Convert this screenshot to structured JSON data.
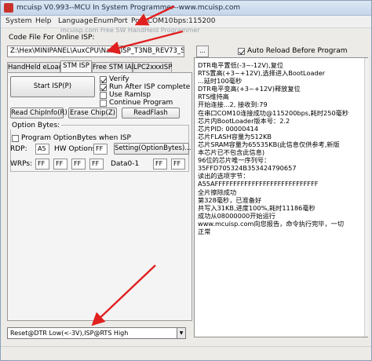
{
  "window": {
    "title": "mcuisp V0.993--MCU In System Programmer--www.mcuisp.com"
  },
  "menu": {
    "items": [
      "System",
      "Help",
      "Language",
      "EnumPort",
      "Port:COM10",
      "bps:115200"
    ]
  },
  "watermark": "mcuisp.com Free SW HandHeld Programmer",
  "codefile": {
    "label": "Code File For Online ISP:",
    "path": "Z:\\Hex\\MINIPANEL\\AuxCPU\\Nano\\ISP_T3NB_REV73_ST.hex",
    "browse_label": "...",
    "auto_reload_label": "Auto Reload Before Program",
    "auto_reload_checked": true
  },
  "tabs": [
    "HandHeld eLoader",
    "STM ISP",
    "Free STM IAP",
    "LPC2xxxISP"
  ],
  "active_tab": "STM ISP",
  "isp": {
    "start_label": "Start ISP(P)",
    "options": [
      {
        "label": "Verify",
        "checked": true
      },
      {
        "label": "Run After ISP complete",
        "checked": true
      },
      {
        "label": "Use RamIsp",
        "checked": false
      },
      {
        "label": "Continue Program",
        "checked": false
      }
    ],
    "buttons": [
      "Read ChipInfo(R)",
      "Erase Chip(Z)",
      "ReadFlash"
    ]
  },
  "option_bytes": {
    "group_title": "Option Bytes:",
    "program_label": "Program OptionBytes when ISP",
    "program_checked": false,
    "rdp_label": "RDP:",
    "rdp_value": "A5",
    "hw_label": "HW Options:",
    "hw_value": "FF",
    "setting_label": "Setting(OptionBytes)...",
    "wrps_label": "WRPs:",
    "wrps_values": [
      "FF",
      "FF",
      "FF",
      "FF"
    ],
    "data0_label": "Data0-1",
    "data_values": [
      "FF",
      "FF"
    ]
  },
  "dtr_combo": {
    "selected": "Reset@DTR Low(<-3V),ISP@RTS High"
  },
  "log_lines": [
    "DTR电平置低(-3~-12V),复位",
    "RTS置高(+3~+12V),选择进入BootLoader",
    "...延时100毫秒",
    "DTR电平变高(+3~+12V)释放复位",
    "RTS维持高",
    "开始连接...2, 接收到:79",
    "在串口COM10连接成功@115200bps,耗时250毫秒",
    "芯片内BootLoader版本号：2.2",
    "芯片PID: 00000414",
    "芯片FLASH容量为512KB",
    "芯片SRAM容量为65535KB(此信息仅供参考,新版",
    "本芯片已不包含此信息)",
    "96位的芯片唯一序列号：",
    "35FFD705324B353424790657",
    "读出的选项字节：",
    "A55AFFFFFFFFFFFFFFFFFFFFFFFFFFFF",
    "全片擦除成功",
    "第328毫秒，已准备好",
    "共写入31KB,进度100%,耗时11186毫秒",
    "成功从08000000开始运行",
    "www.mcuisp.com向您报告，命令执行完毕，一切",
    "正常"
  ],
  "colors": {
    "arrow": "#e02020",
    "titlebar": "#c6d6ea"
  }
}
